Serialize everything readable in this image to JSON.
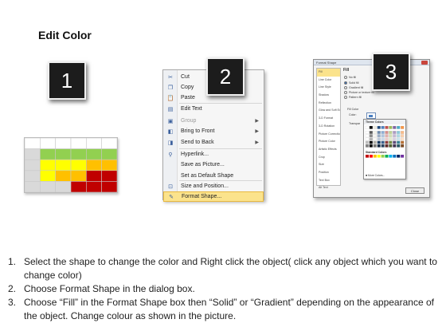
{
  "title": "Edit Color",
  "badges": [
    "1",
    "2",
    "3"
  ],
  "grid_colors": {
    "header": "#ffffff",
    "empty": "#d9d9d9",
    "green": "#92d050",
    "yellow": "#ffff00",
    "orange": "#ffc000",
    "red": "#c00000"
  },
  "context_menu": {
    "items": [
      {
        "label": "Cut",
        "icon": "scissors-icon"
      },
      {
        "label": "Copy",
        "icon": "copy-icon"
      },
      {
        "label": "Paste",
        "icon": "paste-icon"
      },
      {
        "label": "Edit Text",
        "icon": "text-box-icon"
      },
      {
        "label": "Group",
        "icon": "group-icon",
        "disabled": true,
        "submenu": true
      },
      {
        "label": "Bring to Front",
        "icon": "bring-front-icon",
        "submenu": true
      },
      {
        "label": "Send to Back",
        "icon": "send-back-icon",
        "submenu": true
      },
      {
        "label": "Hyperlink...",
        "icon": "hyperlink-icon"
      },
      {
        "label": "Save as Picture...",
        "icon": ""
      },
      {
        "label": "Set as Default Shape",
        "icon": ""
      },
      {
        "label": "Size and Position...",
        "icon": "size-icon"
      },
      {
        "label": "Format Shape...",
        "icon": "format-icon",
        "selected": true
      }
    ]
  },
  "format_dialog": {
    "title": "Format Shape",
    "categories": [
      "Fill",
      "Line Color",
      "Line Style",
      "Shadow",
      "Reflection",
      "Glow and Soft Edges",
      "3-D Format",
      "3-D Rotation",
      "Picture Corrections",
      "Picture Color",
      "Artistic Effects",
      "Crop",
      "Size",
      "Position",
      "Text Box",
      "Alt Text"
    ],
    "fill_heading": "Fill",
    "options": [
      "No fill",
      "Solid fill",
      "Gradient fill",
      "Picture or texture fill",
      "Pattern fill"
    ],
    "fill_color_label": "Fill Color",
    "color_label": "Color:",
    "transparency_label": "Transpar",
    "theme_colors_label": "Theme Colors",
    "standard_colors_label": "Standard Colors",
    "more_colors_label": "More Colors...",
    "close_label": "Close"
  },
  "steps": [
    {
      "num": "1.",
      "text": "Select the shape to change the color and Right click the object( click any object which you want to change color)"
    },
    {
      "num": "2.",
      "text": "Choose Format Shape in the dialog box."
    },
    {
      "num": "3.",
      "text": "Choose “Fill” in the Format Shape box then “Solid” or “Gradient” depending on the appearance of the object. Change colour as shown in the picture."
    }
  ]
}
